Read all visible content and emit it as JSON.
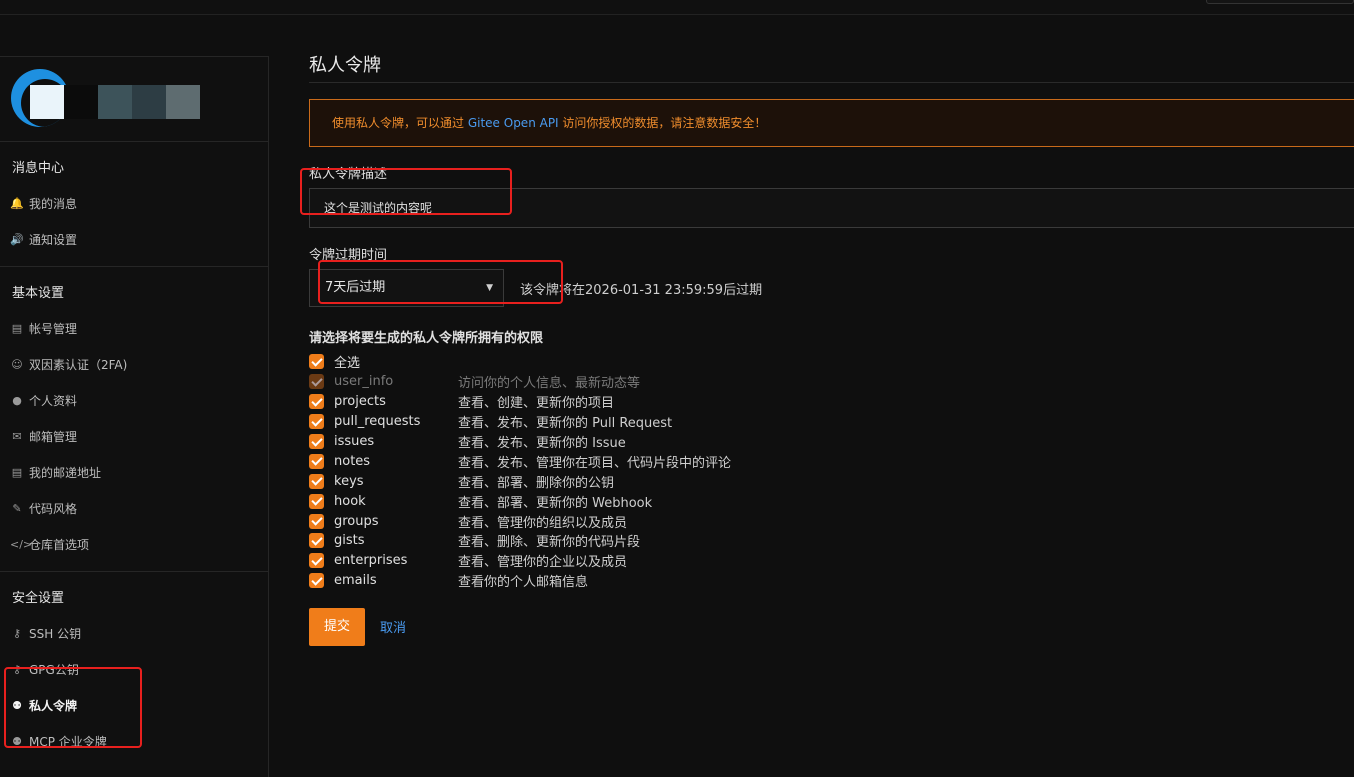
{
  "sidebar": {
    "sections": [
      {
        "title": "消息中心",
        "items": [
          {
            "label": "我的消息",
            "icon": "bell-icon"
          },
          {
            "label": "通知设置",
            "icon": "volume-icon"
          }
        ]
      },
      {
        "title": "基本设置",
        "items": [
          {
            "label": "帐号管理",
            "icon": "id-card-icon"
          },
          {
            "label": "双因素认证（2FA)",
            "icon": "user-lock-icon"
          },
          {
            "label": "个人资料",
            "icon": "user-icon"
          },
          {
            "label": "邮箱管理",
            "icon": "envelope-icon"
          },
          {
            "label": "我的邮递地址",
            "icon": "address-card-icon"
          },
          {
            "label": "代码风格",
            "icon": "brush-icon"
          },
          {
            "label": "仓库首选项",
            "icon": "code-icon"
          }
        ]
      },
      {
        "title": "安全设置",
        "items": [
          {
            "label": "SSH 公钥",
            "icon": "key-icon"
          },
          {
            "label": "GPG公钥",
            "icon": "key-icon"
          },
          {
            "label": "私人令牌",
            "icon": "user-secret-icon"
          },
          {
            "label": "MCP 企业令牌",
            "icon": "user-secret-icon"
          }
        ]
      }
    ]
  },
  "main": {
    "title": "私人令牌",
    "notice": {
      "prefix": "使用私人令牌，可以通过 ",
      "link": "Gitee Open API",
      "suffix": " 访问你授权的数据，请注意数据安全！"
    },
    "description_label": "私人令牌描述",
    "description_value": "这个是测试的内容呢",
    "expire_label": "令牌过期时间",
    "expire_selected": "7天后过期",
    "expire_note": "该令牌将在2026-01-31 23:59:59后过期",
    "permissions_title": "请选择将要生成的私人令牌所拥有的权限",
    "select_all": "全选",
    "permissions": [
      {
        "name": "user_info",
        "desc": "访问你的个人信息、最新动态等",
        "disabled": true
      },
      {
        "name": "projects",
        "desc": "查看、创建、更新你的项目"
      },
      {
        "name": "pull_requests",
        "desc": "查看、发布、更新你的 Pull Request"
      },
      {
        "name": "issues",
        "desc": "查看、发布、更新你的 Issue"
      },
      {
        "name": "notes",
        "desc": "查看、发布、管理你在项目、代码片段中的评论"
      },
      {
        "name": "keys",
        "desc": "查看、部署、删除你的公钥"
      },
      {
        "name": "hook",
        "desc": "查看、部署、更新你的 Webhook"
      },
      {
        "name": "groups",
        "desc": "查看、管理你的组织以及成员"
      },
      {
        "name": "gists",
        "desc": "查看、删除、更新你的代码片段"
      },
      {
        "name": "enterprises",
        "desc": "查看、管理你的企业以及成员"
      },
      {
        "name": "emails",
        "desc": "查看你的个人邮箱信息"
      }
    ],
    "submit_label": "提交",
    "cancel_label": "取消"
  },
  "colors": {
    "accent": "#f07d1a",
    "link": "#4a9bf0",
    "annotation": "#e8201e"
  }
}
